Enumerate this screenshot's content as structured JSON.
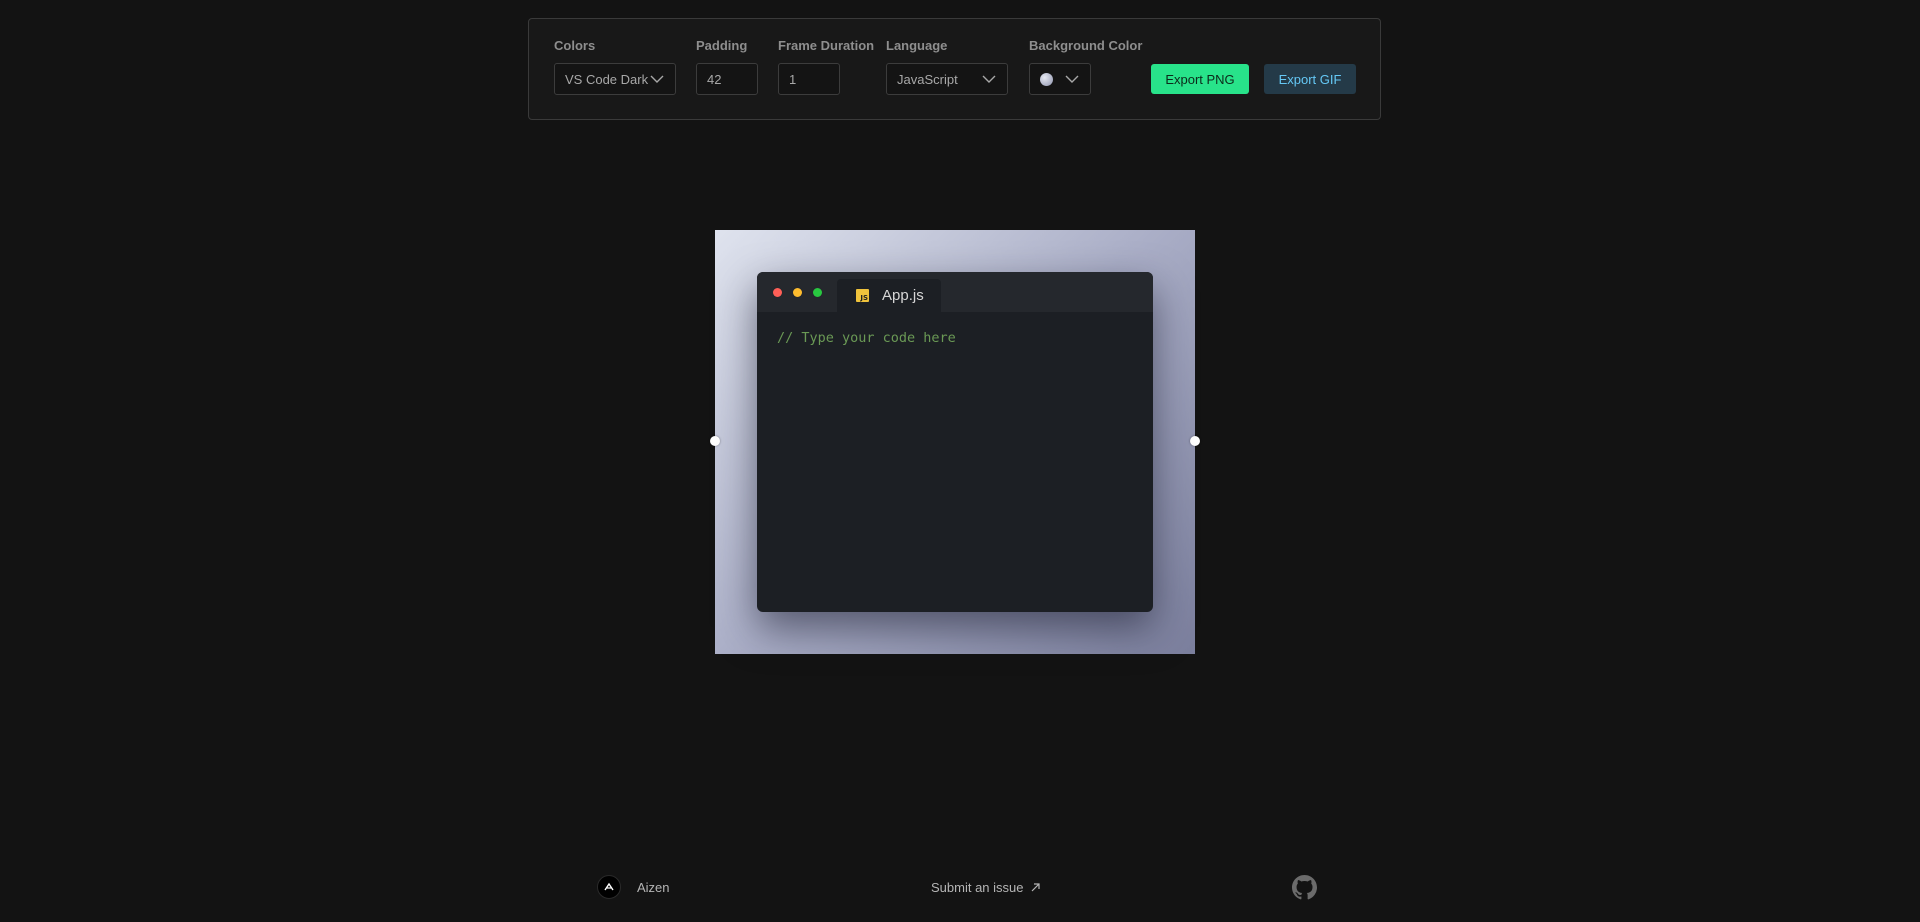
{
  "toolbar": {
    "colors": {
      "label": "Colors",
      "value": "VS Code Dark"
    },
    "padding": {
      "label": "Padding",
      "value": "42"
    },
    "frame_duration": {
      "label": "Frame Duration",
      "value": "1"
    },
    "language": {
      "label": "Language",
      "value": "JavaScript"
    },
    "background_color": {
      "label": "Background Color",
      "swatch_color": "#b9bdd0"
    },
    "export_png_label": "Export PNG",
    "export_gif_label": "Export GIF"
  },
  "editor": {
    "tab_name": "App.js",
    "file_icon": "js-file-icon",
    "file_icon_text": "JS",
    "code": "// Type your code here",
    "background_gradient": [
      "#dfe3ee",
      "#a9adc6",
      "#7b7f9d"
    ]
  },
  "footer": {
    "brand": "Aizen",
    "issue_link": "Submit an issue",
    "issue_link_icon": "arrow-up-right-icon",
    "github_icon": "github-icon"
  },
  "colors": {
    "accent_green": "#28e38a",
    "accent_blue": "#65c8f5",
    "page_background": "#131313"
  }
}
